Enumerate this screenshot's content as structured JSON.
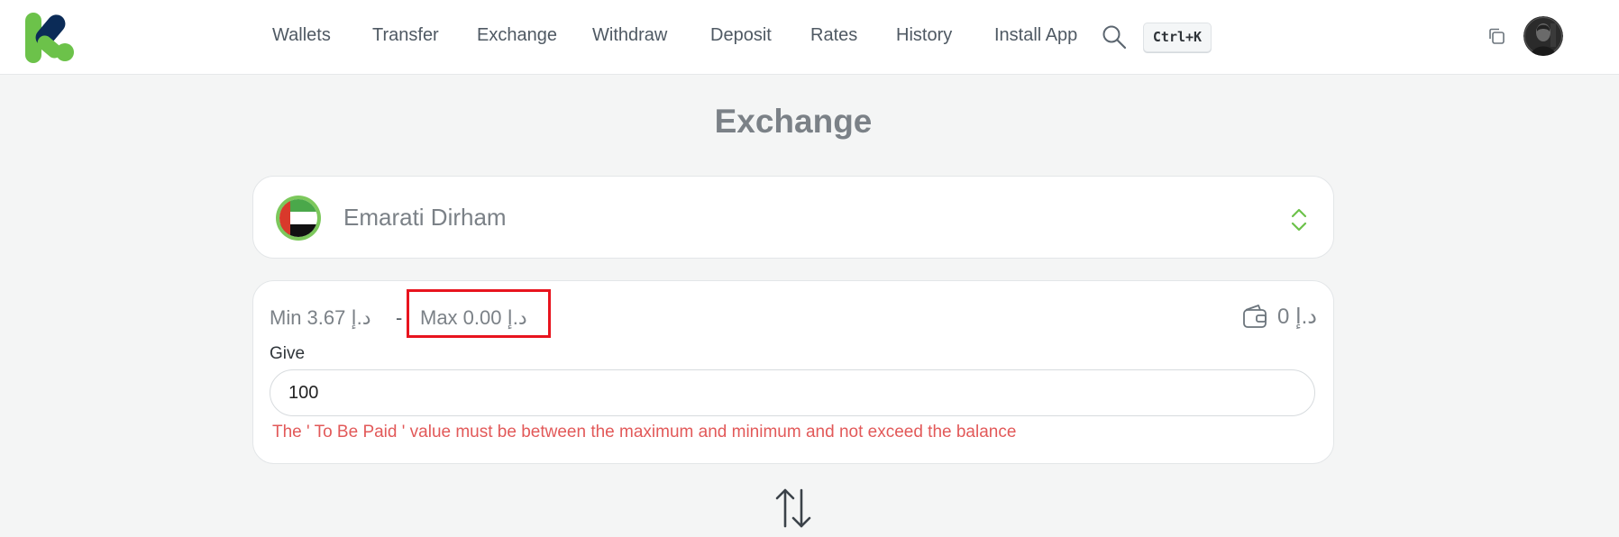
{
  "brand": {
    "logo": "k-logo"
  },
  "nav": {
    "items": [
      {
        "label": "Wallets"
      },
      {
        "label": "Transfer"
      },
      {
        "label": "Exchange"
      },
      {
        "label": "Withdraw"
      },
      {
        "label": "Deposit"
      },
      {
        "label": "Rates"
      },
      {
        "label": "History"
      },
      {
        "label": "Install App"
      }
    ],
    "search_icon": "search-icon",
    "shortcut": "Ctrl+K"
  },
  "header_actions": {
    "copy_icon": "copy-icon",
    "avatar": "user-avatar"
  },
  "page": {
    "title": "Exchange"
  },
  "currency": {
    "name": "Emarati Dirham",
    "flag_icon": "uae-flag-icon",
    "chevron_icon": "chevron-up-down-icon"
  },
  "give": {
    "min_text": "Min 3.67 د.إ",
    "dash": "-",
    "max_text": "Max 0.00 د.إ",
    "balance_text": "د.إ 0",
    "wallet_icon": "wallet-icon",
    "label": "Give",
    "value": "100",
    "error": "The ' To Be Paid ' value must be between the maximum and minimum and not exceed the balance"
  },
  "swap": {
    "icon": "swap-arrows-icon"
  },
  "colors": {
    "accent_green": "#6cc24a",
    "navy": "#0b2b57",
    "error_red": "#e25959",
    "highlight_red": "#e8141e"
  }
}
